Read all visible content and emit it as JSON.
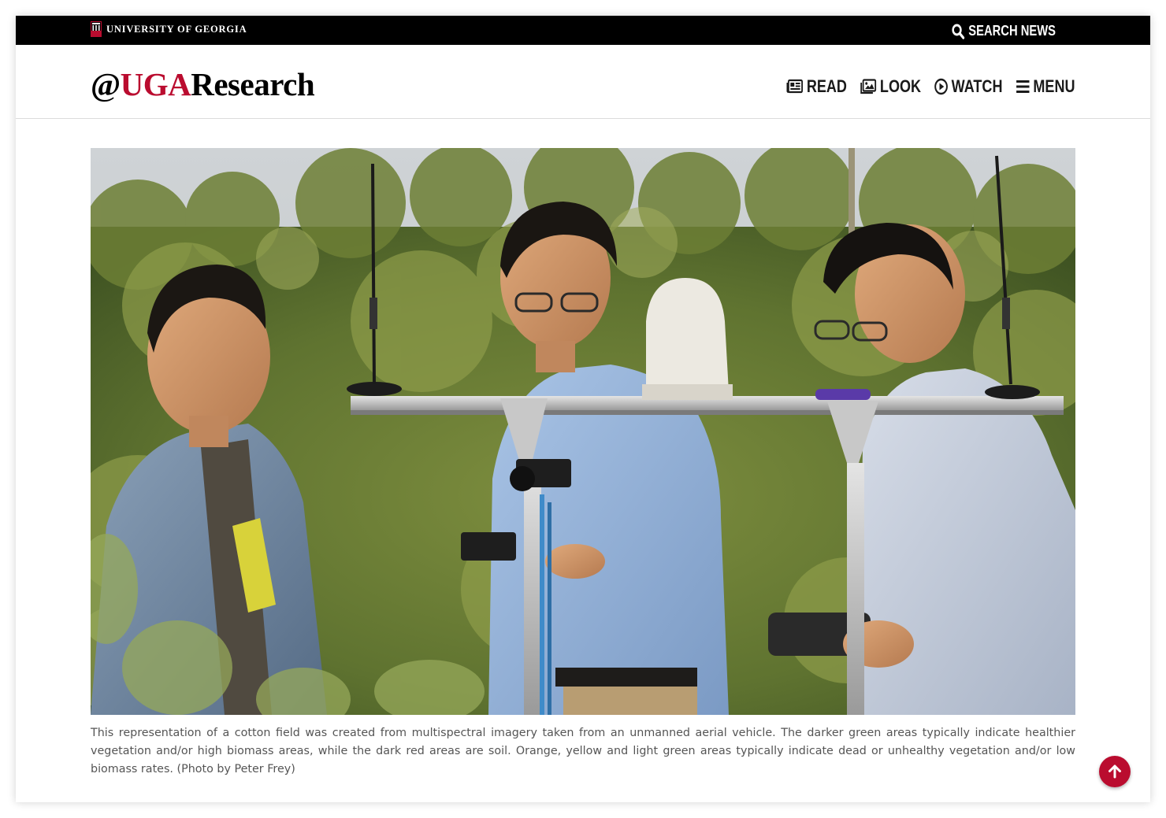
{
  "topbar": {
    "university_name": "UNIVERSITY OF GEORGIA",
    "search_label": "SEARCH NEWS"
  },
  "header": {
    "logo_at": "@",
    "logo_uga": "UGA",
    "logo_research": "Research",
    "nav": [
      {
        "label": "READ",
        "icon": "newspaper-icon"
      },
      {
        "label": "LOOK",
        "icon": "images-icon"
      },
      {
        "label": "WATCH",
        "icon": "play-circle-icon"
      },
      {
        "label": "MENU",
        "icon": "hamburger-icon"
      }
    ]
  },
  "photo": {
    "description": "Three researchers standing in a blueberry field beside a sensor rig with antennas, cameras and a GPS dome"
  },
  "caption": "This representation of a cotton field was created from multispectral imagery taken from an unmanned aerial vehicle. The darker green areas typically indicate healthier vegetation and/or high biomass areas, while the dark red areas are soil. Orange, yellow and light green areas typically indicate dead or unhealthy vegetation and/or low biomass rates. (Photo by Peter Frey)",
  "back_to_top": {
    "icon": "arrow-up-icon"
  },
  "colors": {
    "brand_red": "#ba0c2f",
    "topbar": "#000000"
  }
}
